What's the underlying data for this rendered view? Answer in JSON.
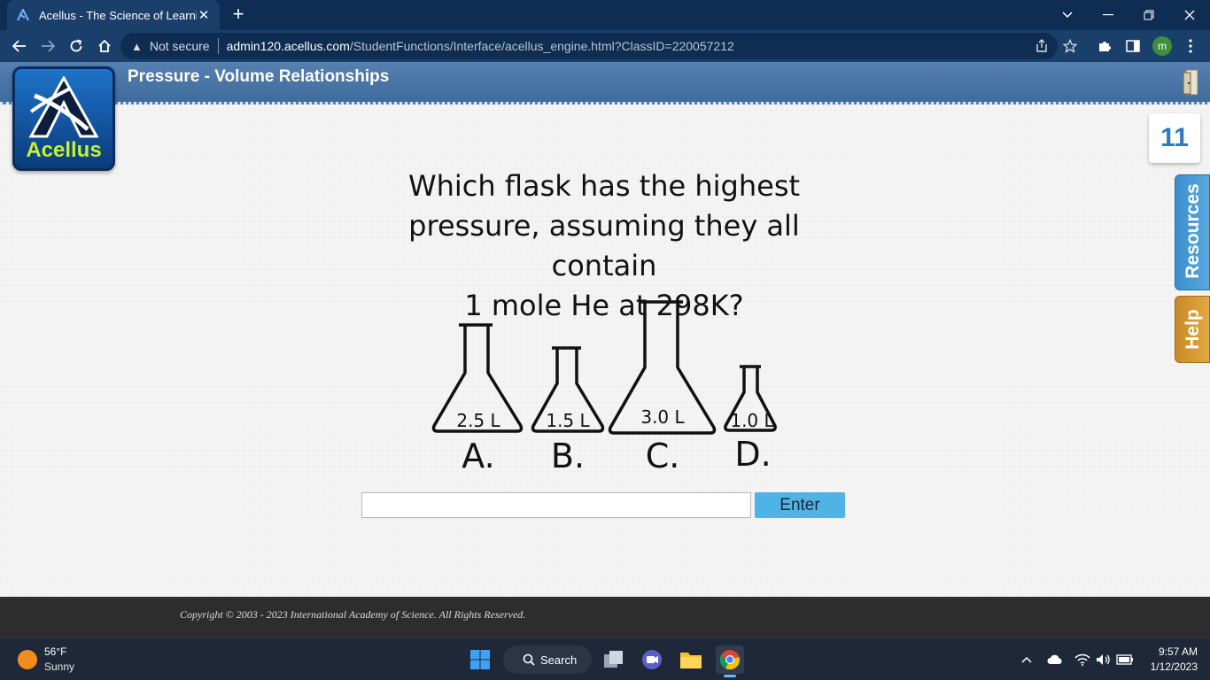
{
  "browser": {
    "tab_title": "Acellus - The Science of Learning",
    "tab_close": "✕",
    "new_tab": "+",
    "security_label": "Not secure",
    "url_host": "admin120.acellus.com",
    "url_path": "/StudentFunctions/Interface/acellus_engine.html?ClassID=220057212",
    "profile_initial": "m"
  },
  "app": {
    "lesson_title": "Pressure - Volume Relationships",
    "logo_text": "Acellus",
    "question_counter": "11",
    "side_tabs": {
      "resources": "Resources",
      "help": "Help"
    }
  },
  "question": {
    "line1": "Which flask has the highest",
    "line2": "pressure, assuming they all contain",
    "line3": "1 mole He at 298K?",
    "flasks": [
      {
        "letter": "A.",
        "volume": "2.5 L"
      },
      {
        "letter": "B.",
        "volume": "1.5 L"
      },
      {
        "letter": "C.",
        "volume": "3.0 L"
      },
      {
        "letter": "D.",
        "volume": "1.0 L"
      }
    ]
  },
  "answer": {
    "value": "",
    "placeholder": "",
    "enter_label": "Enter"
  },
  "footer": {
    "copyright": "Copyright © 2003 - 2023 International Academy of Science.  All Rights Reserved."
  },
  "taskbar": {
    "temperature": "56°F",
    "condition": "Sunny",
    "search_label": "Search",
    "time": "9:57 AM",
    "date": "1/12/2023"
  },
  "colors": {
    "header": "#4a76a8",
    "enter_button": "#4fb3e6",
    "resources_tab": "#4a9fd8",
    "help_tab": "#d99a36",
    "logo_text": "#c6f033"
  }
}
